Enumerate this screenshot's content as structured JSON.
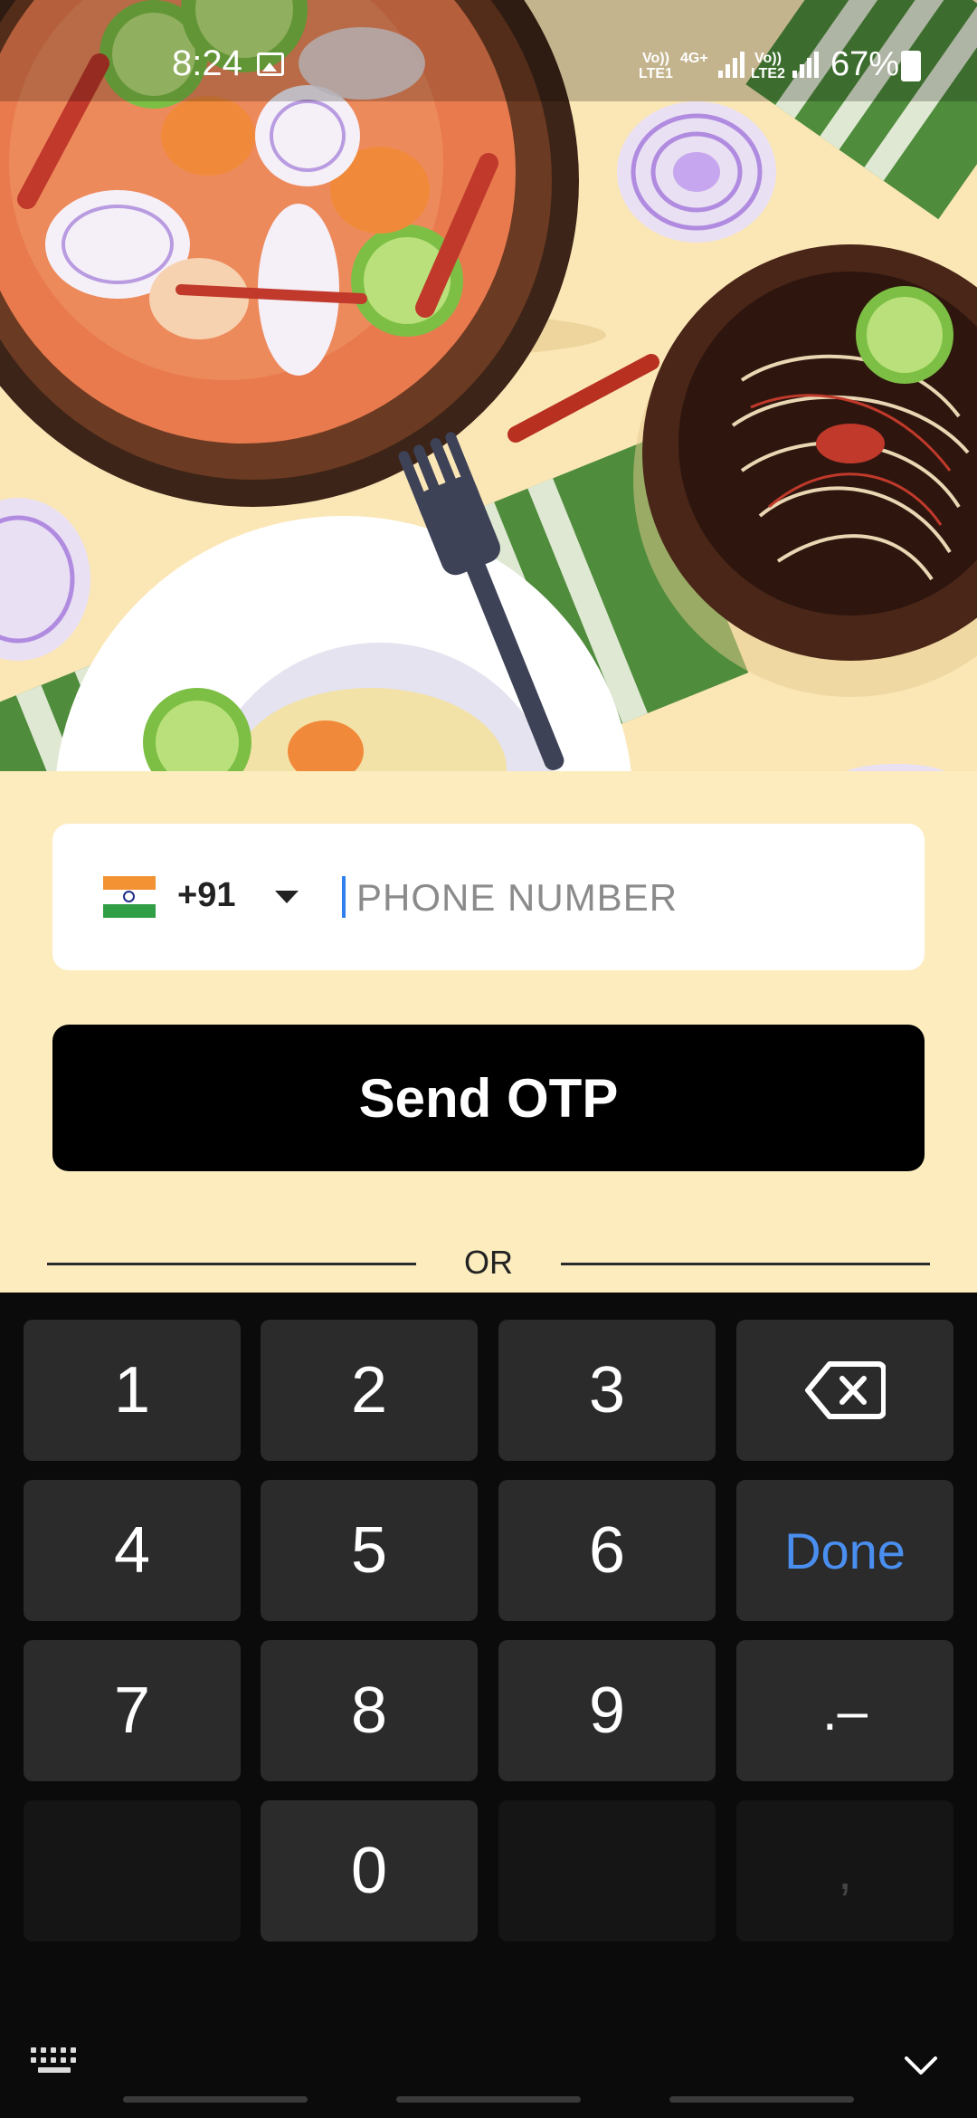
{
  "status_bar": {
    "time": "8:24",
    "sim1_label_top": "Vo))",
    "sim1_label_bottom": "LTE1",
    "sim1_data_label": "4G+",
    "sim2_label_top": "Vo))",
    "sim2_label_bottom": "LTE2",
    "battery": "67%",
    "icons": [
      "gallery-icon",
      "signal-icon",
      "battery-icon"
    ]
  },
  "hero": {
    "description_icons": [
      "soup-bowl-illustration",
      "noodle-bowl-illustration",
      "rice-plate-illustration",
      "fork-illustration",
      "onion-illustration",
      "lime-illustration",
      "chili-illustration"
    ]
  },
  "phone": {
    "country_flag": "india-flag-icon",
    "dial_code": "+91",
    "placeholder": "PHONE NUMBER",
    "value": ""
  },
  "actions": {
    "send_otp": "Send OTP",
    "divider": "OR"
  },
  "keyboard": {
    "row1": [
      "1",
      "2",
      "3"
    ],
    "row2": [
      "4",
      "5",
      "6"
    ],
    "row3": [
      "7",
      "8",
      "9"
    ],
    "row4": [
      "0"
    ],
    "done": "Done",
    "punct": ".–",
    "comma": ",",
    "colors": {
      "background": "#0b0b0b",
      "key": "#2b2b2b",
      "done": "#4a8ff0"
    }
  },
  "colors": {
    "page_background": "#fcecbe",
    "button_background": "#000000",
    "cursor": "#2f80ed"
  }
}
